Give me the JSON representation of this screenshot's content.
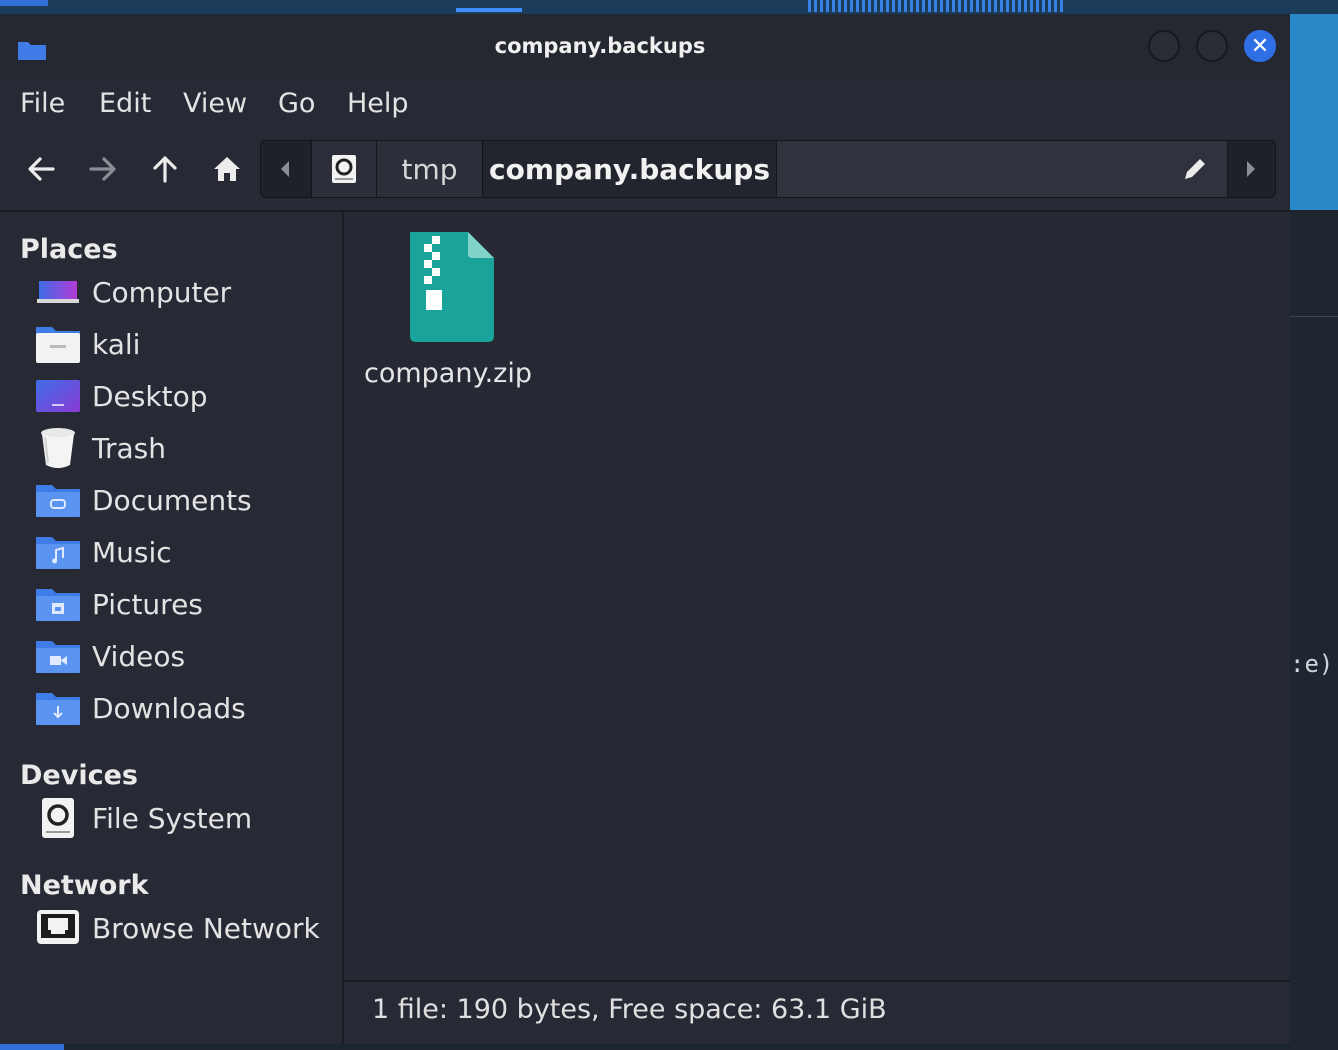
{
  "window": {
    "title": "company.backups",
    "close_glyph": "✕"
  },
  "menu": [
    "File",
    "Edit",
    "View",
    "Go",
    "Help"
  ],
  "toolbar": {
    "icons": [
      "back-arrow-icon",
      "forward-arrow-icon",
      "up-arrow-icon",
      "home-icon"
    ]
  },
  "pathbar": {
    "segments": [
      "tmp",
      "company.backups"
    ],
    "current": "company.backups"
  },
  "sidebar": {
    "places_heading": "Places",
    "places": [
      {
        "label": "Computer",
        "icon": "computer-icon"
      },
      {
        "label": "kali",
        "icon": "home-folder-icon"
      },
      {
        "label": "Desktop",
        "icon": "desktop-icon"
      },
      {
        "label": "Trash",
        "icon": "trash-icon"
      },
      {
        "label": "Documents",
        "icon": "documents-folder-icon"
      },
      {
        "label": "Music",
        "icon": "music-folder-icon"
      },
      {
        "label": "Pictures",
        "icon": "pictures-folder-icon"
      },
      {
        "label": "Videos",
        "icon": "videos-folder-icon"
      },
      {
        "label": "Downloads",
        "icon": "downloads-folder-icon"
      }
    ],
    "devices_heading": "Devices",
    "devices": [
      {
        "label": "File System",
        "icon": "drive-icon"
      }
    ],
    "network_heading": "Network",
    "network": [
      {
        "label": "Browse Network",
        "icon": "network-icon"
      }
    ]
  },
  "content": {
    "files": [
      {
        "name": "company.zip",
        "icon": "zip-archive-icon"
      }
    ]
  },
  "status": "1 file: 190 bytes, Free space: 63.1 GiB",
  "desktop_fragment": ":e).",
  "colors": {
    "accent": "#2f6fe6",
    "zip": "#1aa39a",
    "folder": "#3f7ce8"
  }
}
